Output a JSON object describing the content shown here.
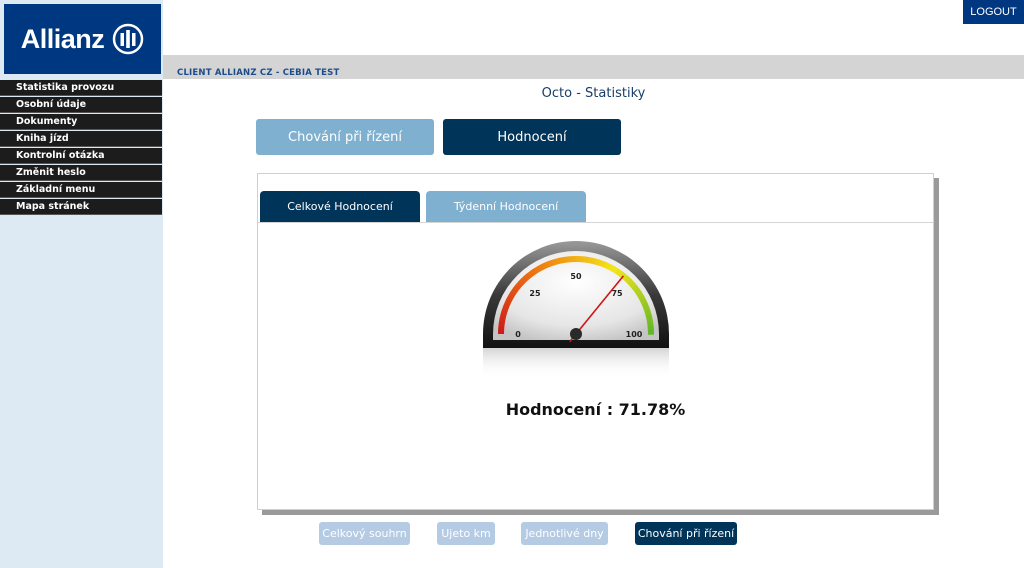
{
  "header": {
    "logo_text": "Allianz",
    "logout_label": "LOGOUT",
    "client_label": "CLIENT ALLIANZ CZ - CEBIA TEST"
  },
  "sidebar": {
    "items": [
      {
        "label": "Statistika provozu"
      },
      {
        "label": "Osobní údaje"
      },
      {
        "label": "Dokumenty"
      },
      {
        "label": "Kniha jízd"
      },
      {
        "label": "Kontrolní otázka"
      },
      {
        "label": "Změnit heslo"
      },
      {
        "label": "Základní menu"
      },
      {
        "label": "Mapa stránek"
      }
    ]
  },
  "main": {
    "page_title": "Octo - Statistiky",
    "toggle": {
      "chovani_label": "Chování při řízení",
      "hodnoceni_label": "Hodnocení",
      "active": "Hodnocení"
    },
    "tabs": [
      {
        "label": "Celkové Hodnocení",
        "active": true
      },
      {
        "label": "Týdenní Hodnocení",
        "active": false
      }
    ],
    "gauge": {
      "min": 0,
      "max": 100,
      "value": 71.78,
      "ticks": [
        "0",
        "25",
        "50",
        "75",
        "100"
      ],
      "colors": [
        "#cc1a1a",
        "#f07a10",
        "#f3e61a",
        "#5fb52b"
      ]
    },
    "score_text": "Hodnocení : 71.78%",
    "bottom_buttons": [
      {
        "label": "Celkový souhrn",
        "active": false
      },
      {
        "label": "Ujeto km",
        "active": false
      },
      {
        "label": "Jednotlivé dny",
        "active": false
      },
      {
        "label": "Chování při řízení",
        "active": true
      }
    ]
  },
  "colors": {
    "brand_blue": "#003781",
    "dark_navy": "#003459",
    "light_blue": "#7fb0d0",
    "pale_blue": "#b4cbe3",
    "sidebar_bg": "#dde9f3"
  }
}
